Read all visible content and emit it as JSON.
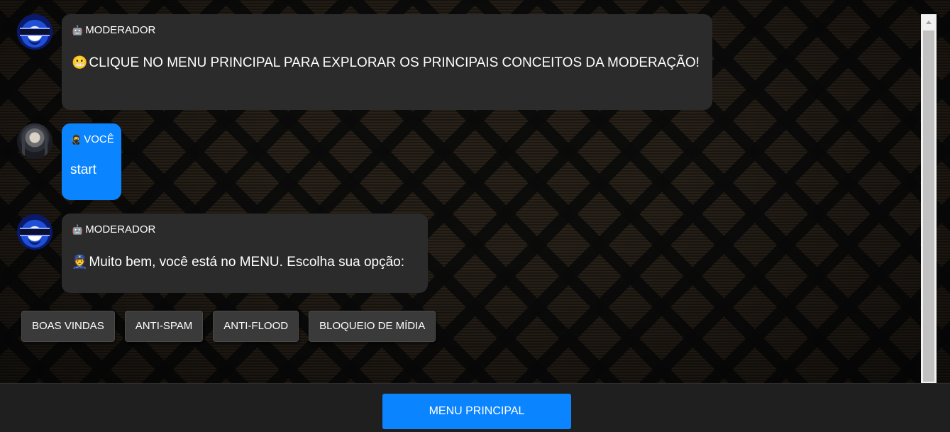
{
  "messages": [
    {
      "role": "bot",
      "sender_icon": "robot-icon",
      "sender_emoji": "🤖",
      "sender": "MODERADOR",
      "text_icon": "grimacing-face-icon",
      "text_emoji": "😬",
      "text": "CLIQUE NO MENU PRINCIPAL PARA EXPLORAR OS PRINCIPAIS CONCEITOS DA MODERAÇÃO!"
    },
    {
      "role": "user",
      "sender_icon": "person-icon",
      "sender_emoji": "🥷",
      "sender": "VOCÊ",
      "text": "start"
    },
    {
      "role": "bot",
      "sender_icon": "robot-icon",
      "sender_emoji": "🤖",
      "sender": "MODERADOR",
      "text_icon": "police-officer-icon",
      "text_emoji": "👮",
      "text": "Muito bem, você está no MENU. Escolha sua opção:"
    }
  ],
  "options": [
    "BOAS VINDAS",
    "ANTI-SPAM",
    "ANTI-FLOOD",
    "BLOQUEIO DE MÍDIA"
  ],
  "main_menu_label": "MENU PRINCIPAL",
  "colors": {
    "accent": "#0a84ff",
    "bubble_bot": "#2b2b2b",
    "bubble_user": "#0a84ff",
    "bottom_bar": "#1f1f1f"
  }
}
